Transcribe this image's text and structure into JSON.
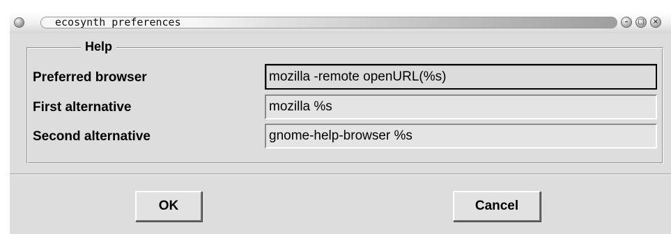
{
  "window": {
    "title": "ecosynth preferences",
    "controls": {
      "minimize_icon": "minimize-icon",
      "maximize_icon": "maximize-icon",
      "close_icon": "close-icon"
    }
  },
  "help": {
    "legend": "Help",
    "rows": [
      {
        "label": "Preferred browser",
        "value": "mozilla -remote openURL(%s)"
      },
      {
        "label": "First alternative",
        "value": "mozilla %s"
      },
      {
        "label": "Second alternative",
        "value": "gnome-help-browser %s"
      }
    ]
  },
  "buttons": {
    "ok_label": "OK",
    "cancel_label": "Cancel"
  },
  "colors": {
    "window_background": "#dddddd",
    "title_text": "#111111",
    "focus_border": "#000000"
  }
}
